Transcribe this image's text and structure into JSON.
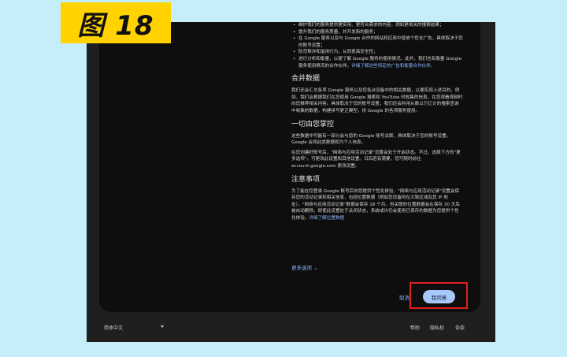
{
  "annotation": {
    "label": "图 18"
  },
  "content": {
    "bullets_top": [
      "维护我们的服务提供更实用、更符合需求的内容，例如更相关的搜索结果；",
      "提升我们的服务质量，并开发新的服务；",
      "在 Google 服务以及与 Google 合作的网站和应用中投放个性化广告，具体取决于您的账号设置；",
      "防范欺诈和滥用行为，从而提高安全性；",
      "进行分析和衡量，以便了解 Google 服务的使用情况。此外，我们也有衡量 Google 服务使用情况的合作伙伴。"
    ],
    "bullets_link": "详细了解这些特定的广告和衡量合作伙伴。",
    "sections": [
      {
        "title": "合并数据",
        "paragraphs": [
          "我们还会汇总各项 Google 服务以及您各台设备中的相关数据，以便实现上述目的。例如，我们会根据我们在您使用 Google 搜索和 YouTube 时收集的信息，在您观看视频时向您推荐相关内容。具体取决于您的账号设置，我们还会利用从数以万亿计的搜索查询中收集的数据，构建拼写更正模型，供 Google 的各项服务使用。"
        ]
      },
      {
        "title": "一切由您掌控",
        "paragraphs": [
          "这些数据中可能有一部分会与您的 Google 账号关联，具体取决于您的账号设置。Google 会将此类数据视为个人信息。",
          "在您创建好账号后，\"网络与应用活动记录\"设置会处于开启状态。不过，选择下方的\"更多选项\"，可更改此设置和其他设置。日后若有需要，您可随时前往 account.google.com 更改设置。"
        ]
      },
      {
        "title": "注意事项",
        "paragraphs": [
          "为了能在您登录 Google 账号后向您提供个性化体验，\"网络与应用活动记录\"设置会保存您的活动记录和相关信息，包括位置数据（例如您设备所在大致区域及其 IP 地址）。\"网络与应用活动记录\"数据会保存 18 个月。但关联的位置数据会在保存 30 天后被自动删除。即使此设置处于关闭状态，系统或许仍会使用已保存的数据为您提供个性化体验。"
        ],
        "link": "详细了解位置数据"
      }
    ]
  },
  "more_options": "更多选项",
  "buttons": {
    "cancel": "取消",
    "agree": "我同意"
  },
  "footer": {
    "language": "简体中文",
    "help": "帮助",
    "privacy": "隐私权",
    "terms": "条款"
  }
}
